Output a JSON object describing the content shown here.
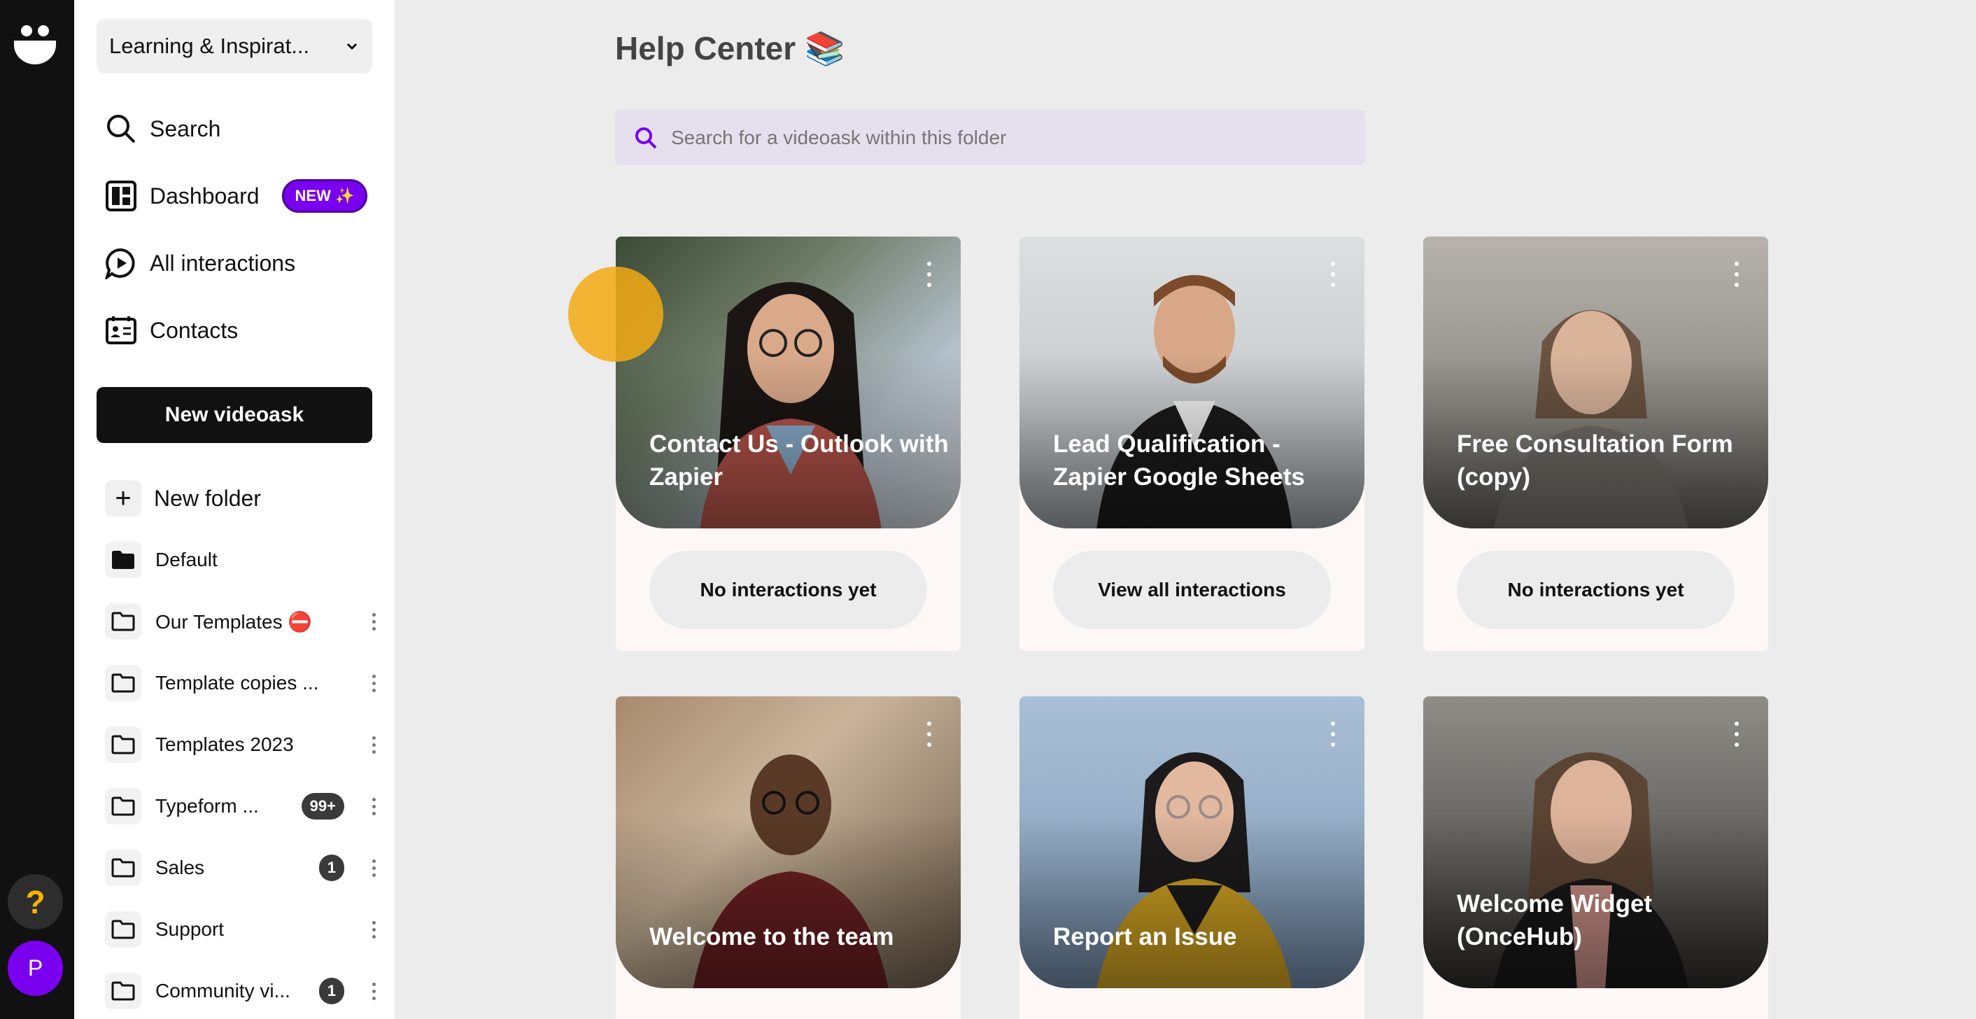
{
  "sidebar": {
    "folder_selector": "Learning & Inspirat...",
    "nav": [
      {
        "label": "Search",
        "icon": "search-icon"
      },
      {
        "label": "Dashboard",
        "icon": "dashboard-icon",
        "badge": "NEW ✨"
      },
      {
        "label": "All interactions",
        "icon": "interactions-icon"
      },
      {
        "label": "Contacts",
        "icon": "contacts-icon"
      }
    ],
    "new_videoask": "New videoask",
    "new_folder": "New folder",
    "folders": [
      {
        "name": "Default",
        "icon": "folder-filled-icon"
      },
      {
        "name": "Our Templates ⛔",
        "icon": "folder-icon"
      },
      {
        "name": "Template copies ...",
        "icon": "folder-icon"
      },
      {
        "name": "Templates 2023",
        "icon": "folder-icon"
      },
      {
        "name": "Typeform ...",
        "icon": "folder-icon",
        "count": "99+"
      },
      {
        "name": "Sales",
        "icon": "folder-icon",
        "count": "1"
      },
      {
        "name": "Support",
        "icon": "folder-icon"
      },
      {
        "name": "Community vi...",
        "icon": "folder-icon",
        "count": "1"
      }
    ]
  },
  "rail": {
    "help": "?",
    "avatar": "P"
  },
  "main": {
    "title": "Help Center 📚",
    "search_placeholder": "Search for a videoask within this folder",
    "cards": [
      {
        "title": "Contact Us - Outlook with Zapier",
        "button": "No interactions yet"
      },
      {
        "title": "Lead Qualification - Zapier Google Sheets",
        "button": "View all interactions"
      },
      {
        "title": "Free Consultation Form (copy)",
        "button": "No interactions yet"
      },
      {
        "title": "Welcome to the team"
      },
      {
        "title": "Report an Issue"
      },
      {
        "title": "Welcome Widget (OnceHub)"
      }
    ]
  },
  "colors": {
    "accent": "#7a00f0",
    "rail": "#111111",
    "help": "#f5b400"
  }
}
